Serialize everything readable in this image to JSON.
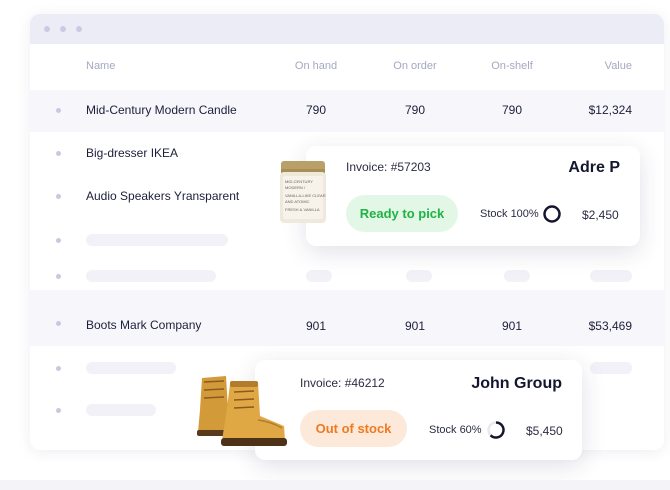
{
  "table": {
    "headers": {
      "name": "Name",
      "on_hand": "On hand",
      "on_order": "On order",
      "on_shelf": "On-shelf",
      "value": "Value"
    },
    "rows": [
      {
        "name": "Mid-Century Modern Candle",
        "on_hand": "790",
        "on_order": "790",
        "on_shelf": "790",
        "value": "$12,324"
      },
      {
        "name": "Big-dresser IKEA"
      },
      {
        "name": "Audio Speakers Yransparent"
      },
      {
        "name": "Boots Mark Company",
        "on_hand": "901",
        "on_order": "901",
        "on_shelf": "901",
        "value": "$53,469"
      }
    ]
  },
  "cards": [
    {
      "invoice": "Invoice: #57203",
      "customer": "Adre P",
      "status": "Ready to pick",
      "stock_label": "Stock 100%",
      "stock_level": 1.0,
      "amount": "$2,450",
      "status_color": "#1fb344",
      "product_icon": "candle-jar-image",
      "jar_label_lines": [
        "MID-CENTURY",
        "MODERN /",
        "VANILLA-LIKE CLEAR",
        "AND ATOMIC",
        "FRESH & VANILLA"
      ]
    },
    {
      "invoice": "Invoice: #46212",
      "customer": "John Group",
      "status": "Out of stock",
      "stock_label": "Stock 60%",
      "stock_level": 0.6,
      "amount": "$5,450",
      "status_color": "#f07a22",
      "product_icon": "boots-image"
    }
  ],
  "colors": {
    "accent_dark": "#1d1f3a",
    "green": "#1fb344",
    "orange": "#f07a22",
    "header_bg": "#ececf7"
  }
}
